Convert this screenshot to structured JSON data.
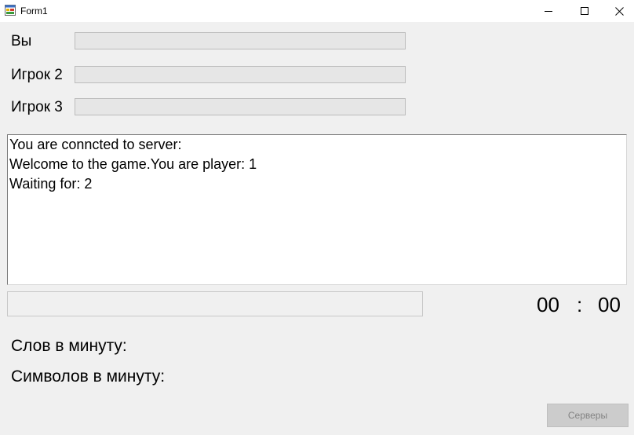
{
  "window": {
    "title": "Form1",
    "icon": "winforms-app-icon",
    "controls": [
      "minimize-icon",
      "maximize-icon",
      "close-icon"
    ]
  },
  "players": [
    {
      "label": "Вы",
      "progress": 0
    },
    {
      "label": "Игрок 2",
      "progress": 0
    },
    {
      "label": "Игрок 3",
      "progress": 0
    }
  ],
  "log": {
    "lines": [
      "You are conncted to server:",
      "Welcome to the game.You are player: 1",
      "Waiting for: 2"
    ]
  },
  "input": {
    "value": ""
  },
  "timer": {
    "minutes": "00",
    "separator": ":",
    "seconds": "00"
  },
  "stats": {
    "words_per_minute_label": "Слов в минуту:",
    "chars_per_minute_label": "Символов в минуту:"
  },
  "buttons": {
    "servers_label": "Серверы",
    "servers_enabled": false
  },
  "colors": {
    "background": "#f0f0f0",
    "progress_fill": "#06b025"
  }
}
